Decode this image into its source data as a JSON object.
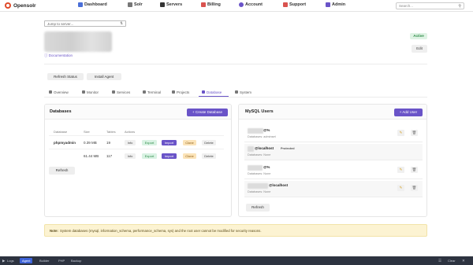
{
  "brand": {
    "name": "Opensolr",
    "logo_color": "#e04b2a"
  },
  "nav": {
    "items": [
      {
        "label": "Dashboard",
        "icon": "dashboard-icon",
        "color": "#4a6fd8"
      },
      {
        "label": "Solr",
        "icon": "solr-icon",
        "color": "#555555"
      },
      {
        "label": "Servers",
        "icon": "servers-icon",
        "color": "#333333"
      },
      {
        "label": "Billing",
        "icon": "billing-icon",
        "color": "#d9534f"
      },
      {
        "label": "Account",
        "icon": "account-icon",
        "color": "#6a54c8"
      },
      {
        "label": "Support",
        "icon": "support-icon",
        "color": "#d9534f"
      },
      {
        "label": "Admin",
        "icon": "admin-icon",
        "color": "#6a54c8"
      }
    ],
    "search_placeholder": "Search..."
  },
  "server": {
    "jump_placeholder": "Jump to server...",
    "documentation_link": "Documentation",
    "status_badge": "Active",
    "edit_label": "Edit"
  },
  "actions": {
    "refresh_status": "Refresh Status",
    "install_agent": "Install Agent"
  },
  "tabs": [
    {
      "label": "Overview",
      "active": false
    },
    {
      "label": "Monitor",
      "active": false
    },
    {
      "label": "Services",
      "active": false
    },
    {
      "label": "Terminal",
      "active": false
    },
    {
      "label": "Projects",
      "active": false
    },
    {
      "label": "Database",
      "active": true
    },
    {
      "label": "System",
      "active": false
    }
  ],
  "databases": {
    "title": "Databases",
    "create_label": "+ Create Database",
    "columns": [
      "Database",
      "Size",
      "Tables",
      "Actions"
    ],
    "rows": [
      {
        "name": "phpmyadmin",
        "size": "0.39 MB",
        "tables": "19"
      },
      {
        "name": "",
        "size": "61.44 MB",
        "tables": "117"
      }
    ],
    "row_actions": [
      "Info",
      "Export",
      "Import",
      "Clone",
      "Delete"
    ],
    "refresh_label": "Refresh"
  },
  "mysql_users": {
    "title": "MySQL Users",
    "add_label": "+ Add User",
    "users": [
      {
        "name": "@%",
        "databases": "Databases: adminset",
        "protected": "",
        "editable": true
      },
      {
        "name": "@localhost",
        "databases": "Databases: None",
        "protected": "Protected",
        "editable": false
      },
      {
        "name": "@%",
        "databases": "Databases: None",
        "protected": "",
        "editable": true
      },
      {
        "name": "@localhost",
        "databases": "Databases: None",
        "protected": "",
        "editable": true
      }
    ],
    "refresh_label": "Refresh"
  },
  "note": {
    "prefix": "Note:",
    "text": "System databases (mysql, information_schema, performance_schema, sys) and the root user cannot be modified for security reasons."
  },
  "bottombar": {
    "items": [
      {
        "label": "Logs",
        "active": false
      },
      {
        "label": "Agent",
        "active": true
      },
      {
        "label": "Builder",
        "active": false
      },
      {
        "label": "PHP",
        "active": false
      },
      {
        "label": "Backup",
        "active": false
      }
    ],
    "clear_label": "Clear"
  },
  "colors": {
    "accent": "#6a54c8",
    "success": "#2b8a46",
    "warning_bg": "#fcf3d2"
  }
}
